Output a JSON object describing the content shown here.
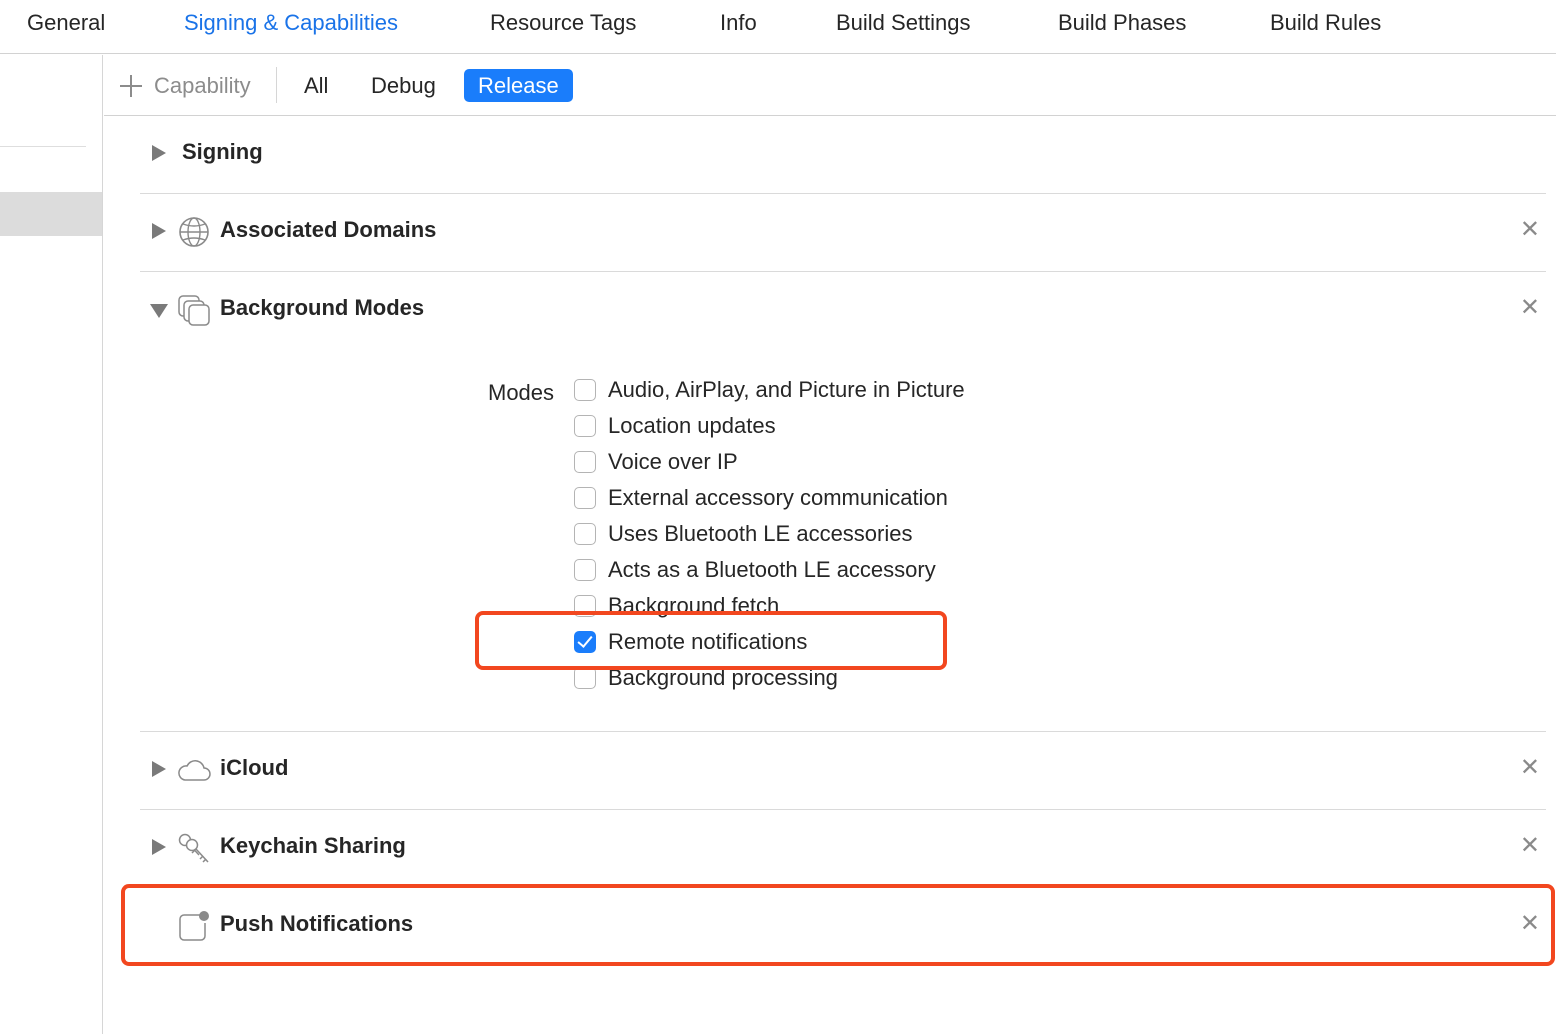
{
  "tabs": [
    {
      "label": "General"
    },
    {
      "label": "Signing & Capabilities",
      "active": true
    },
    {
      "label": "Resource Tags"
    },
    {
      "label": "Info"
    },
    {
      "label": "Build Settings"
    },
    {
      "label": "Build Phases"
    },
    {
      "label": "Build Rules"
    }
  ],
  "filterbar": {
    "add_label": "Capability",
    "segments": [
      "All",
      "Debug",
      "Release"
    ],
    "selected": "Release"
  },
  "sections": {
    "signing": {
      "title": "Signing",
      "icon": "none"
    },
    "associated_domains": {
      "title": "Associated Domains",
      "icon": "globe-icon"
    },
    "background_modes": {
      "title": "Background Modes",
      "icon": "stacked-squares-icon"
    },
    "icloud": {
      "title": "iCloud",
      "icon": "cloud-icon"
    },
    "keychain": {
      "title": "Keychain Sharing",
      "icon": "keys-icon"
    },
    "push": {
      "title": "Push Notifications",
      "icon": "notification-badge-icon"
    }
  },
  "modes": {
    "label": "Modes",
    "items": [
      {
        "label": "Audio, AirPlay, and Picture in Picture",
        "checked": false
      },
      {
        "label": "Location updates",
        "checked": false
      },
      {
        "label": "Voice over IP",
        "checked": false
      },
      {
        "label": "External accessory communication",
        "checked": false
      },
      {
        "label": "Uses Bluetooth LE accessories",
        "checked": false
      },
      {
        "label": "Acts as a Bluetooth LE accessory",
        "checked": false
      },
      {
        "label": "Background fetch",
        "checked": false
      },
      {
        "label": "Remote notifications",
        "checked": true
      },
      {
        "label": "Background processing",
        "checked": false
      }
    ]
  },
  "close_glyph": "✕",
  "colors": {
    "accent": "#1a7dfb",
    "highlight": "#f2471f"
  }
}
